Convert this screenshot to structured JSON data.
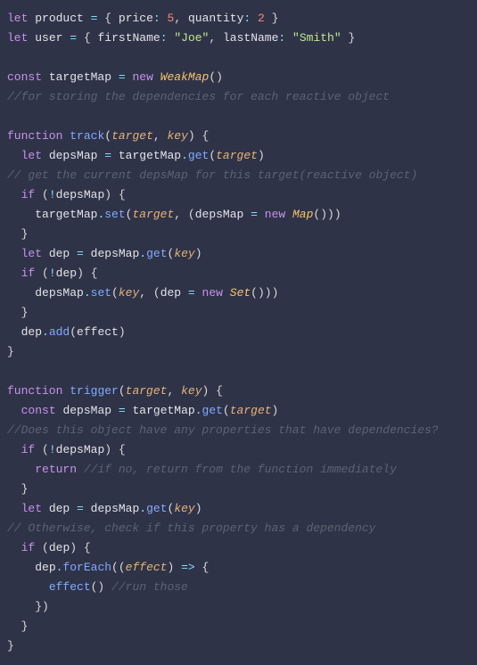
{
  "code": {
    "l01": {
      "kw_let": "let",
      "var_product": "product",
      "op_eq": "=",
      "punc_ob": "{",
      "prop_price": "price",
      "punc_colon": ":",
      "num_5": "5",
      "punc_comma": ",",
      "prop_quantity": "quantity",
      "num_2": "2",
      "punc_cb": "}"
    },
    "l02": {
      "kw_let": "let",
      "var_user": "user",
      "op_eq": "=",
      "punc_ob": "{",
      "prop_firstName": "firstName",
      "punc_colon": ":",
      "str_joe": "\"Joe\"",
      "punc_comma": ",",
      "prop_lastName": "lastName",
      "str_smith": "\"Smith\"",
      "punc_cb": "}"
    },
    "l04": {
      "kw_const": "const",
      "var_targetMap": "targetMap",
      "op_eq": "=",
      "kw_new": "new",
      "cls_WeakMap": "WeakMap",
      "punc_par": "()"
    },
    "l05": {
      "comment": "//for storing the dependencies for each reactive object"
    },
    "l07": {
      "kw_function": "function",
      "fn_track": "track",
      "punc_op": "(",
      "arg_target": "target",
      "punc_comma": ",",
      "arg_key": "key",
      "punc_cp": ")",
      "punc_ob": "{"
    },
    "l08": {
      "kw_let": "let",
      "var_depsMap": "depsMap",
      "op_eq": "=",
      "var_targetMap": "targetMap",
      "op_dot": ".",
      "fn_get": "get",
      "punc_op": "(",
      "arg_target": "target",
      "punc_cp": ")"
    },
    "l09": {
      "comment": "// get the current depsMap for this target(reactive object)"
    },
    "l10": {
      "kw_if": "if",
      "punc_op": "(",
      "op_not": "!",
      "var_depsMap": "depsMap",
      "punc_cp": ")",
      "punc_ob": "{"
    },
    "l11": {
      "var_targetMap": "targetMap",
      "op_dot": ".",
      "fn_set": "set",
      "punc_op": "(",
      "arg_target": "target",
      "punc_comma": ",",
      "punc_op2": "(",
      "var_depsMap": "depsMap",
      "op_eq": "=",
      "kw_new": "new",
      "cls_Map": "Map",
      "punc_par": "()",
      "punc_cp2": ")",
      "punc_cp": ")"
    },
    "l12": {
      "punc_cb": "}"
    },
    "l13": {
      "kw_let": "let",
      "var_dep": "dep",
      "op_eq": "=",
      "var_depsMap": "depsMap",
      "op_dot": ".",
      "fn_get": "get",
      "punc_op": "(",
      "arg_key": "key",
      "punc_cp": ")"
    },
    "l14": {
      "kw_if": "if",
      "punc_op": "(",
      "op_not": "!",
      "var_dep": "dep",
      "punc_cp": ")",
      "punc_ob": "{"
    },
    "l15": {
      "var_depsMap": "depsMap",
      "op_dot": ".",
      "fn_set": "set",
      "punc_op": "(",
      "arg_key": "key",
      "punc_comma": ",",
      "punc_op2": "(",
      "var_dep": "dep",
      "op_eq": "=",
      "kw_new": "new",
      "cls_Set": "Set",
      "punc_par": "()",
      "punc_cp2": ")",
      "punc_cp": ")"
    },
    "l16": {
      "punc_cb": "}"
    },
    "l17": {
      "var_dep": "dep",
      "op_dot": ".",
      "fn_add": "add",
      "punc_op": "(",
      "var_effect": "effect",
      "punc_cp": ")"
    },
    "l18": {
      "punc_cb": "}"
    },
    "l20": {
      "kw_function": "function",
      "fn_trigger": "trigger",
      "punc_op": "(",
      "arg_target": "target",
      "punc_comma": ",",
      "arg_key": "key",
      "punc_cp": ")",
      "punc_ob": "{"
    },
    "l21": {
      "kw_const": "const",
      "var_depsMap": "depsMap",
      "op_eq": "=",
      "var_targetMap": "targetMap",
      "op_dot": ".",
      "fn_get": "get",
      "punc_op": "(",
      "arg_target": "target",
      "punc_cp": ")"
    },
    "l22": {
      "comment": "//Does this object have any properties that have dependencies?"
    },
    "l23": {
      "kw_if": "if",
      "punc_op": "(",
      "op_not": "!",
      "var_depsMap": "depsMap",
      "punc_cp": ")",
      "punc_ob": "{"
    },
    "l24": {
      "kw_return": "return",
      "comment": "//if no, return from the function immediately"
    },
    "l25": {
      "punc_cb": "}"
    },
    "l26": {
      "kw_let": "let",
      "var_dep": "dep",
      "op_eq": "=",
      "var_depsMap": "depsMap",
      "op_dot": ".",
      "fn_get": "get",
      "punc_op": "(",
      "arg_key": "key",
      "punc_cp": ")"
    },
    "l27": {
      "comment": "// Otherwise, check if this property has a dependency"
    },
    "l28": {
      "kw_if": "if",
      "punc_op": "(",
      "var_dep": "dep",
      "punc_cp": ")",
      "punc_ob": "{"
    },
    "l29": {
      "var_dep": "dep",
      "op_dot": ".",
      "fn_forEach": "forEach",
      "punc_op": "(",
      "punc_op2": "(",
      "arg_effect": "effect",
      "punc_cp2": ")",
      "op_arrow": "=>",
      "punc_ob": "{"
    },
    "l30": {
      "fn_effect": "effect",
      "punc_par": "()",
      "comment": "//run those"
    },
    "l31": {
      "punc_cb": "})"
    },
    "l32": {
      "punc_cb": "}"
    },
    "l33": {
      "punc_cb": "}"
    }
  }
}
